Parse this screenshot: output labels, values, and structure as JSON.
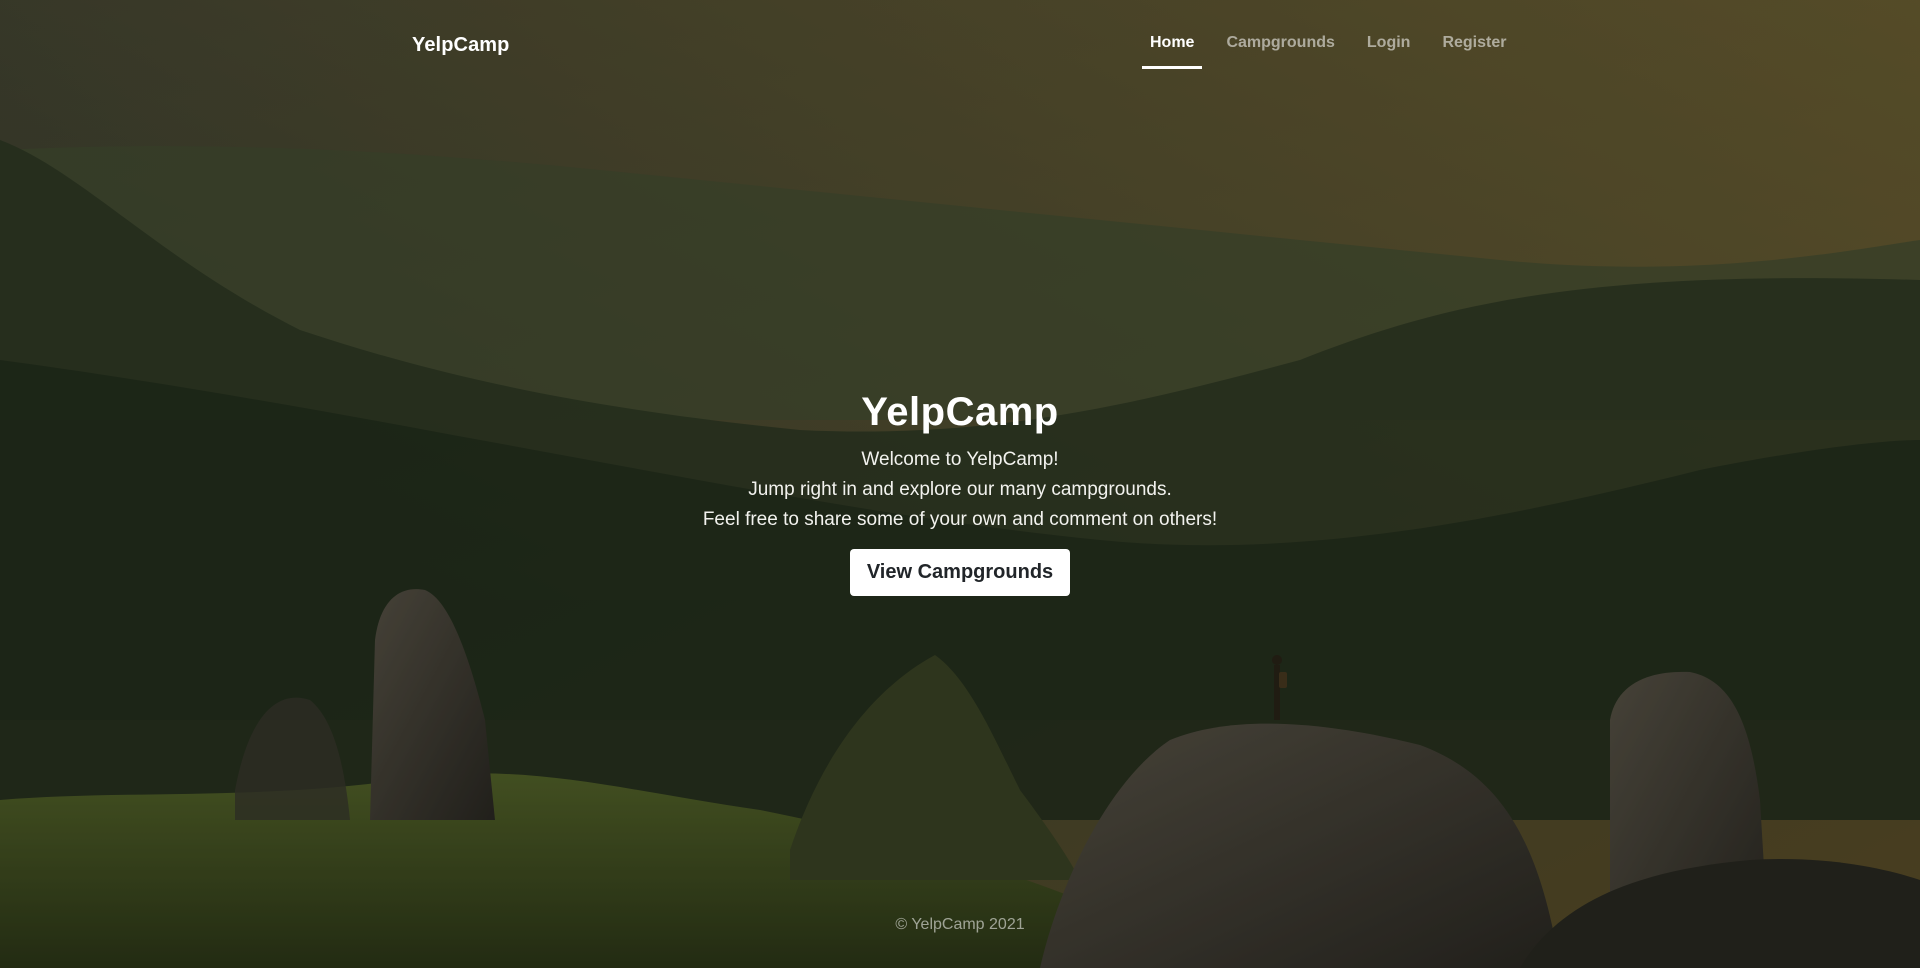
{
  "nav": {
    "brand": "YelpCamp",
    "links": [
      {
        "label": "Home",
        "active": true
      },
      {
        "label": "Campgrounds",
        "active": false
      },
      {
        "label": "Login",
        "active": false
      },
      {
        "label": "Register",
        "active": false
      }
    ]
  },
  "hero": {
    "title": "YelpCamp",
    "lines": [
      "Welcome to YelpCamp!",
      "Jump right in and explore our many campgrounds.",
      "Feel free to share some of your own and comment on others!"
    ],
    "button_label": "View Campgrounds"
  },
  "footer": {
    "text": "© YelpCamp 2021"
  },
  "colors": {
    "accent": "#ffffff",
    "muted_text": "#a9a9a0",
    "button_text": "#212529"
  }
}
